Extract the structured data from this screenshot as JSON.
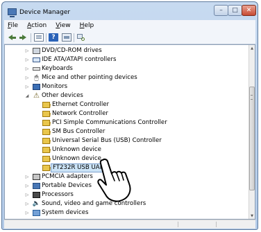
{
  "window": {
    "title": "Device Manager"
  },
  "titlebar": {
    "min_glyph": "–",
    "max_glyph": "□",
    "close_glyph": "✕"
  },
  "menu": [
    {
      "accel": "F",
      "rest": "ile"
    },
    {
      "accel": "A",
      "rest": "ction"
    },
    {
      "accel": "V",
      "rest": "iew"
    },
    {
      "accel": "H",
      "rest": "elp"
    }
  ],
  "toolbar": {
    "help_glyph": "?"
  },
  "tree": {
    "expander_collapsed": "▷",
    "expander_expanded": "◢",
    "rows": [
      {
        "label": "DVD/CD-ROM drives"
      },
      {
        "label": "IDE ATA/ATAPI controllers"
      },
      {
        "label": "Keyboards"
      },
      {
        "label": "Mice and other pointing devices"
      },
      {
        "label": "Monitors"
      },
      {
        "label": "Other devices"
      },
      {
        "label": "Ethernet Controller"
      },
      {
        "label": "Network Controller"
      },
      {
        "label": "PCI Simple Communications Controller"
      },
      {
        "label": "SM Bus Controller"
      },
      {
        "label": "Universal Serial Bus (USB) Controller"
      },
      {
        "label": "Unknown device"
      },
      {
        "label": "Unknown device"
      },
      {
        "label": "FT232R USB UART"
      },
      {
        "label": "PCMCIA adapters"
      },
      {
        "label": "Portable Devices"
      },
      {
        "label": "Processors"
      },
      {
        "label": "Sound, video and game controllers"
      },
      {
        "label": "System devices"
      }
    ]
  },
  "scrollbar": {
    "up_glyph": "▲",
    "down_glyph": "▼"
  },
  "colors": {
    "selection": "#cce4f7",
    "title_gradient_top": "#c7daf0",
    "close_button": "#c74a33"
  }
}
